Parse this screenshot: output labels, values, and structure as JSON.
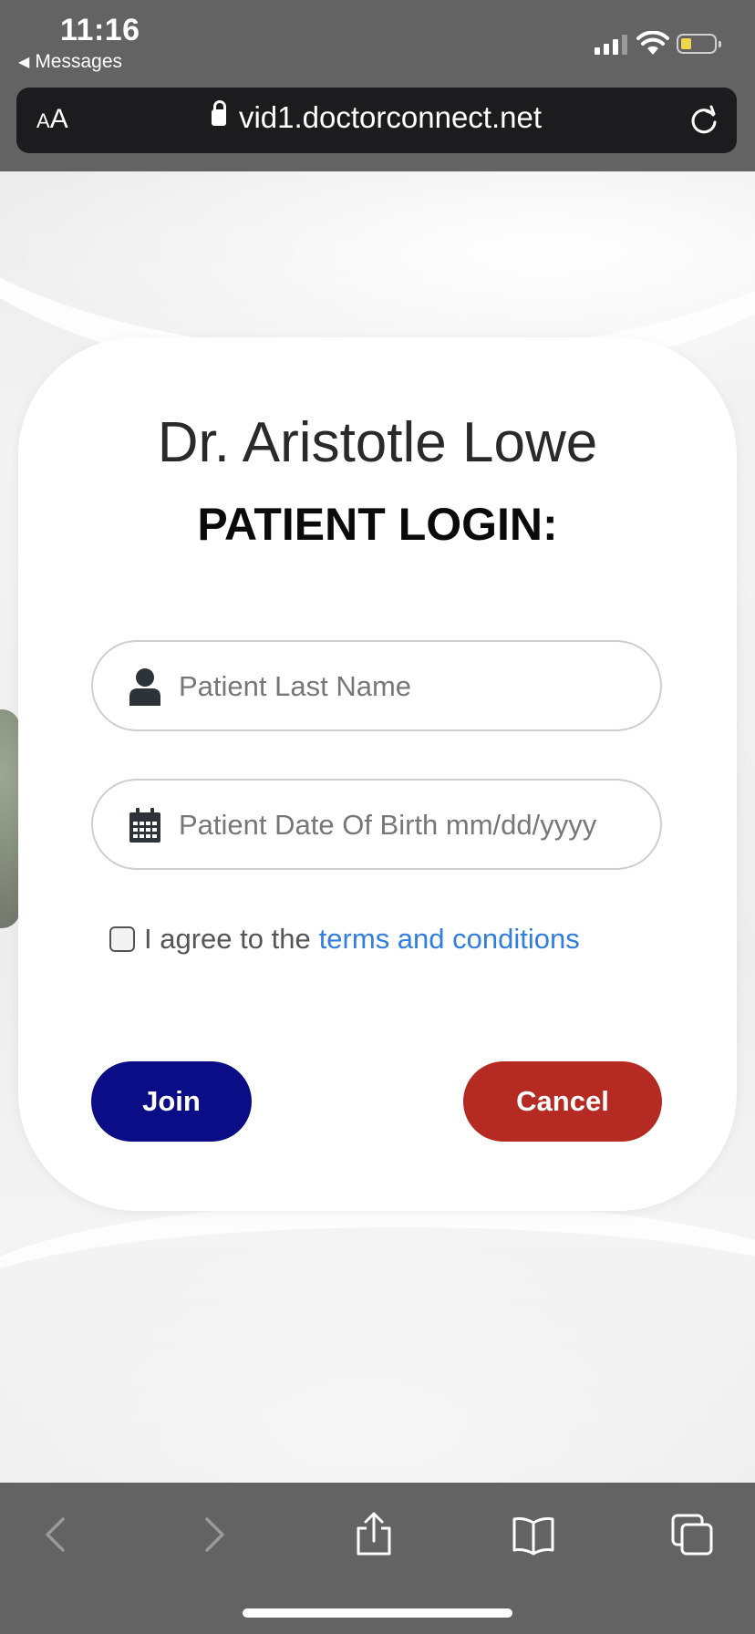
{
  "status_bar": {
    "time": "11:16",
    "back_app": "Messages"
  },
  "browser": {
    "text_size_button": "AA",
    "url": "vid1.doctorconnect.net"
  },
  "login_card": {
    "doctor_name": "Dr. Aristotle Lowe",
    "title": "PATIENT LOGIN:",
    "last_name_placeholder": "Patient Last Name",
    "dob_placeholder": "Patient Date Of Birth mm/dd/yyyy",
    "agree_text": "I agree to the",
    "terms_link": "terms and conditions",
    "join_label": "Join",
    "cancel_label": "Cancel",
    "colors": {
      "join": "#0a0d86",
      "cancel": "#b52a22",
      "link": "#2f7ee0"
    }
  },
  "toolbar": {
    "icons": [
      "back-icon",
      "forward-icon",
      "share-icon",
      "bookmarks-icon",
      "tabs-icon"
    ]
  }
}
